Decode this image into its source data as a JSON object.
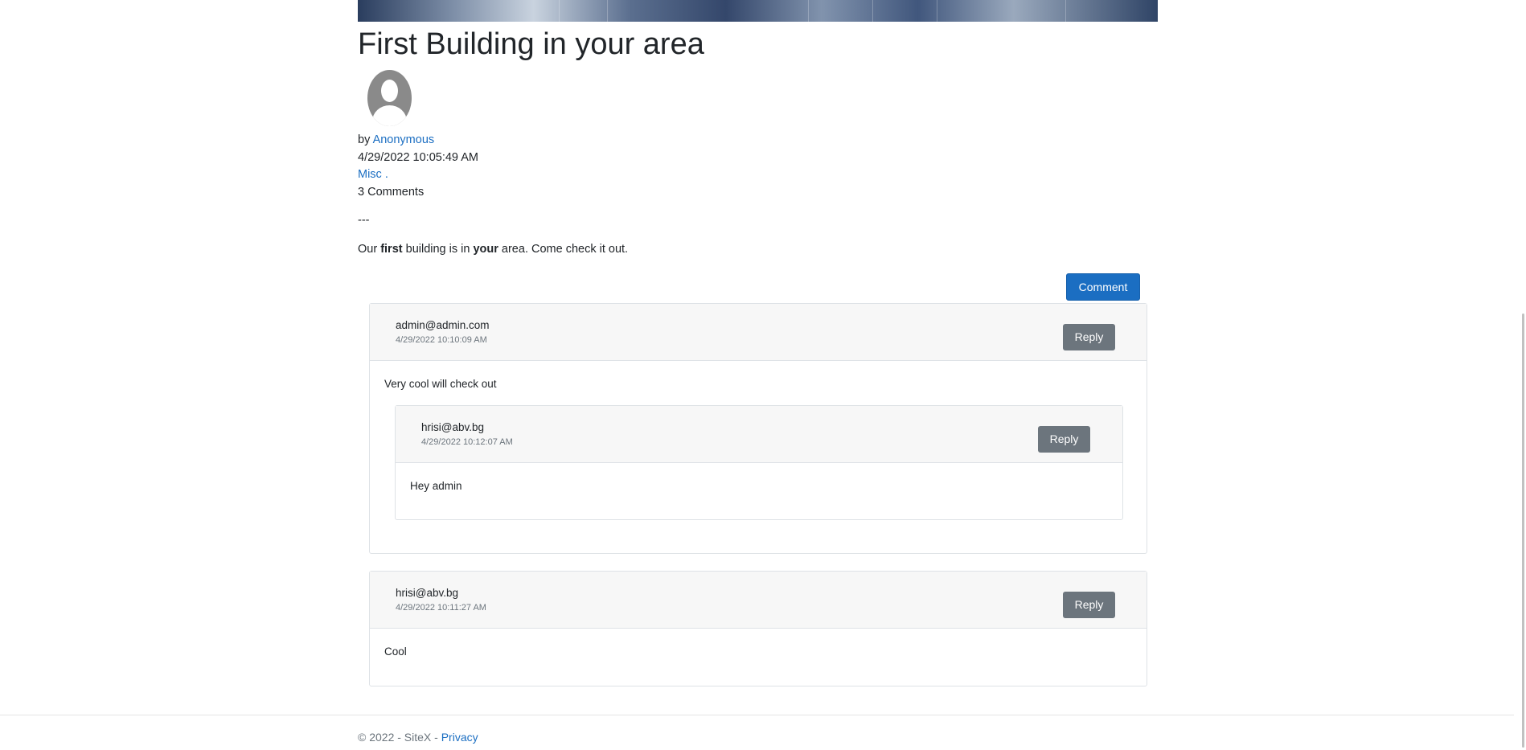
{
  "post": {
    "title": "First Building in your area",
    "by_prefix": "by",
    "author": "Anonymous",
    "date": "4/29/2022 10:05:49 AM",
    "category": "Misc .",
    "comments_count": "3 Comments",
    "separator": "---",
    "content": {
      "part1": "Our ",
      "bold1": "first",
      "part2": " building is in ",
      "bold2": "your",
      "part3": " area. Come check it out."
    }
  },
  "actions": {
    "comment_label": "Comment",
    "reply_label": "Reply"
  },
  "comments": [
    {
      "author": "admin@admin.com",
      "time": "4/29/2022 10:10:09 AM",
      "text": "Very cool will check out",
      "replies": [
        {
          "author": "hrisi@abv.bg",
          "time": "4/29/2022 10:12:07 AM",
          "text": "Hey admin"
        }
      ]
    },
    {
      "author": "hrisi@abv.bg",
      "time": "4/29/2022 10:11:27 AM",
      "text": "Cool"
    }
  ],
  "footer": {
    "copyright": "© 2022 - SiteX - ",
    "privacy_label": "Privacy"
  },
  "colors": {
    "primary": "#1b6ec2",
    "secondary": "#6c757d",
    "link": "#1b6ec2"
  }
}
